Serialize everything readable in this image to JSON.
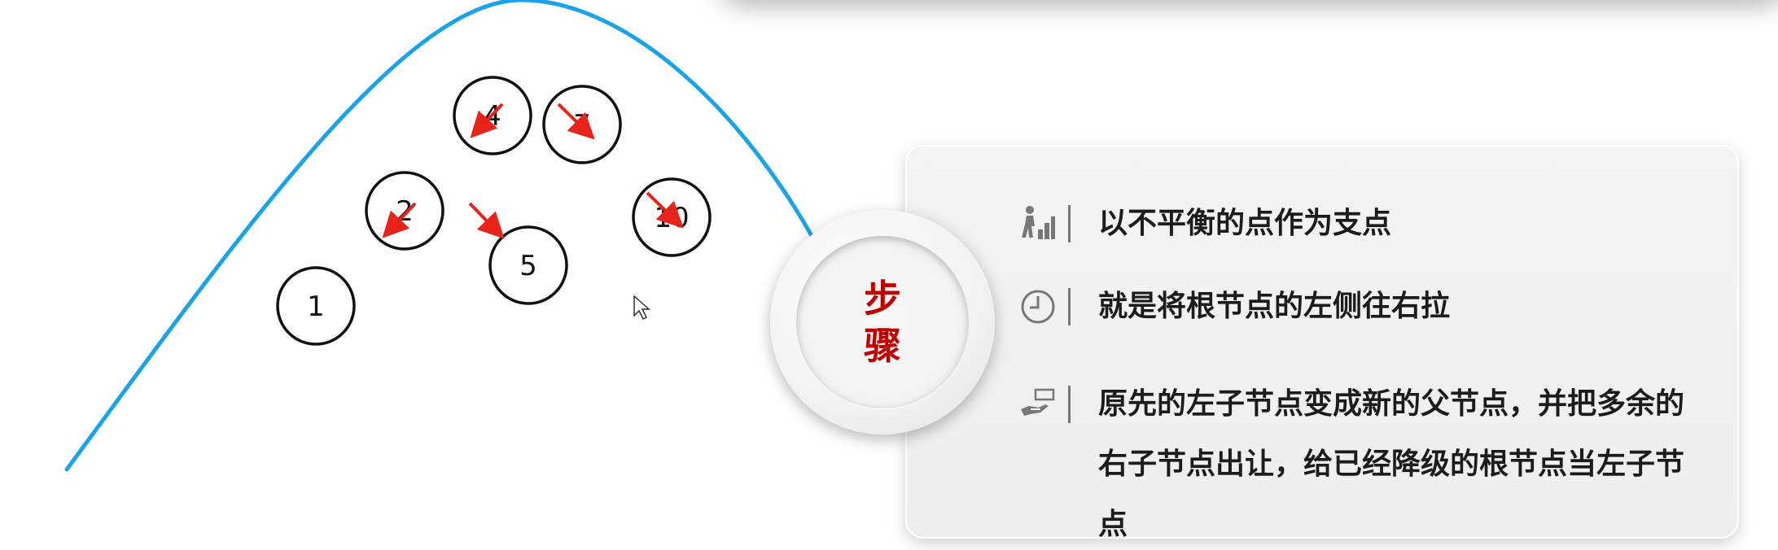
{
  "diagram": {
    "nodes": [
      {
        "id": "n1",
        "label": "1"
      },
      {
        "id": "n2",
        "label": "2"
      },
      {
        "id": "n4",
        "label": "4"
      },
      {
        "id": "n5",
        "label": "5"
      },
      {
        "id": "n7",
        "label": "7"
      },
      {
        "id": "n10",
        "label": "10"
      }
    ],
    "colors": {
      "curve": "#1aa3e8",
      "arrow": "#e8231a",
      "node_stroke": "#111111",
      "badge_text": "#c00000"
    }
  },
  "badge": {
    "text": "步骤"
  },
  "steps": [
    {
      "icon": "person-stairs-icon",
      "text": "以不平衡的点作为支点"
    },
    {
      "icon": "clock-icon",
      "text": "就是将根节点的左侧往右拉"
    },
    {
      "icon": "hand-money-icon",
      "text": "原先的左子节点变成新的父节点，并把多余的右子节点出让，给已经降级的根节点当左子节点"
    }
  ]
}
